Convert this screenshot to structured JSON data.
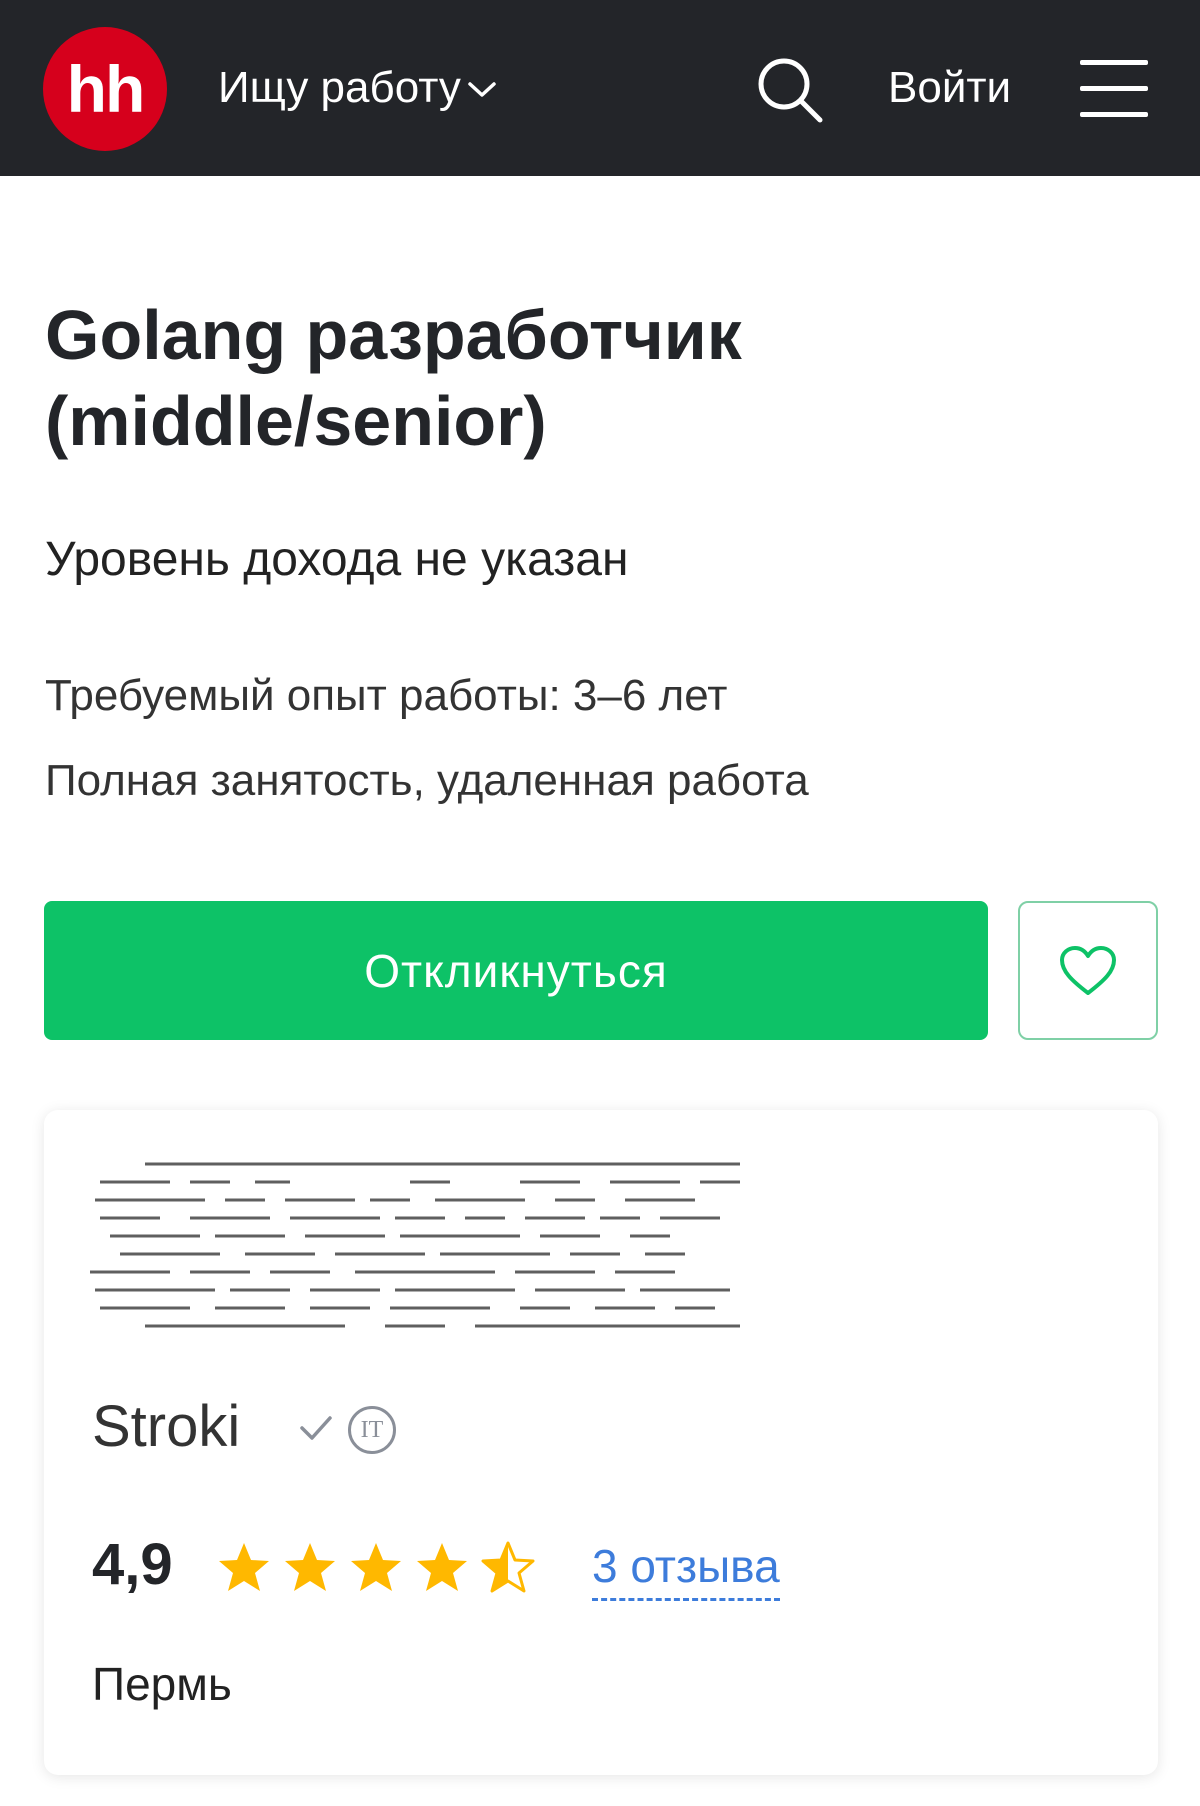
{
  "header": {
    "logo_text": "hh",
    "role_label": "Ищу работу",
    "login_label": "Войти"
  },
  "vacancy": {
    "title": "Golang разработчик (middle/senior)",
    "salary": "Уровень дохода не указан",
    "experience": "Требуемый опыт работы: 3–6 лет",
    "employment": "Полная занятость, удаленная работа",
    "apply_label": "Откликнуться"
  },
  "company": {
    "name": "Stroki",
    "it_badge": "IT",
    "rating": "4,9",
    "rating_value": 4.9,
    "rating_max": 5,
    "reviews_label": "3 отзыва",
    "city": "Пермь"
  },
  "colors": {
    "header_bg": "#232529",
    "logo_red": "#d6001c",
    "apply_green": "#0dc267",
    "star": "#ffb800",
    "link_blue": "#3d7cdb"
  },
  "icons": [
    "search-icon",
    "chevron-down-icon",
    "menu-icon",
    "heart-icon",
    "verified-check-icon",
    "it-badge-icon",
    "star-icon",
    "half-star-icon"
  ]
}
